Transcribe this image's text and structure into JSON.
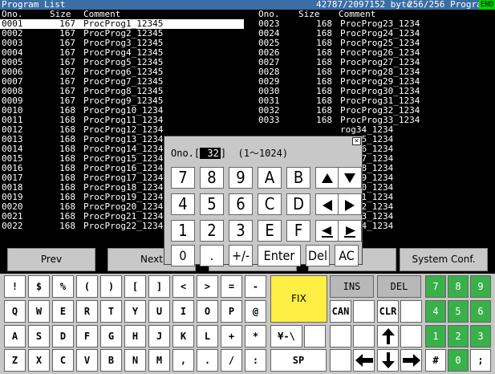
{
  "title": {
    "name": "Program List",
    "memory": "42787/2097152 byte",
    "count": "256/256 Program",
    "end": "END"
  },
  "columns": {
    "no": "Ono.",
    "size": "Size",
    "comment": "Comment"
  },
  "left_rows": [
    [
      "0001",
      "167",
      "ProcProg1_12345"
    ],
    [
      "0002",
      "167",
      "ProcProg2_12345"
    ],
    [
      "0003",
      "167",
      "ProcProg3_12345"
    ],
    [
      "0004",
      "167",
      "ProcProg4_12345"
    ],
    [
      "0005",
      "167",
      "ProcProg5_12345"
    ],
    [
      "0006",
      "167",
      "ProcProg6_12345"
    ],
    [
      "0007",
      "167",
      "ProcProg7_12345"
    ],
    [
      "0008",
      "167",
      "ProcProg8_12345"
    ],
    [
      "0009",
      "167",
      "ProcProg9_12345"
    ],
    [
      "0010",
      "168",
      "ProcProg10_1234"
    ],
    [
      "0011",
      "168",
      "ProcProg11_1234"
    ],
    [
      "0012",
      "168",
      "ProcProg12_1234"
    ],
    [
      "0013",
      "168",
      "ProcProg13_1234"
    ],
    [
      "0014",
      "168",
      "ProcProg14_1234"
    ],
    [
      "0015",
      "168",
      "ProcProg15_1234"
    ],
    [
      "0016",
      "168",
      "ProcProg16_1234"
    ],
    [
      "0017",
      "168",
      "ProcProg17_1234"
    ],
    [
      "0018",
      "168",
      "ProcProg18_1234"
    ],
    [
      "0019",
      "168",
      "ProcProg19_1234"
    ],
    [
      "0020",
      "168",
      "ProcProg20_1234"
    ],
    [
      "0021",
      "168",
      "ProcProg21_1234"
    ],
    [
      "0022",
      "168",
      "ProcProg22_1234"
    ]
  ],
  "right_rows": [
    [
      "0023",
      "168",
      "ProcProg23_1234"
    ],
    [
      "0024",
      "168",
      "ProcProg24_1234"
    ],
    [
      "0025",
      "168",
      "ProcProg25_1234"
    ],
    [
      "0026",
      "168",
      "ProcProg26_1234"
    ],
    [
      "0027",
      "168",
      "ProcProg27_1234"
    ],
    [
      "0028",
      "168",
      "ProcProg28_1234"
    ],
    [
      "0029",
      "168",
      "ProcProg29_1234"
    ],
    [
      "0030",
      "168",
      "ProcProg30_1234"
    ],
    [
      "0031",
      "168",
      "ProcProg31_1234"
    ],
    [
      "0032",
      "168",
      "ProcProg32_1234"
    ],
    [
      "0033",
      "168",
      "ProcProg33_1234"
    ],
    [
      "",
      "",
      "rog34_1234"
    ],
    [
      "",
      "",
      "rog35_1234"
    ],
    [
      "",
      "",
      "rog36_1234"
    ],
    [
      "",
      "",
      "rog37_1234"
    ],
    [
      "",
      "",
      "rog38_1234"
    ],
    [
      "",
      "",
      "rog39_1234"
    ],
    [
      "",
      "",
      "rog40_1234"
    ],
    [
      "",
      "",
      "rog41_1234"
    ],
    [
      "",
      "",
      "rog42_1234"
    ],
    [
      "",
      "",
      "rog43_1234"
    ],
    [
      "",
      "",
      "rog44_1234"
    ]
  ],
  "fkeys": {
    "prev": "Prev",
    "next": "Next",
    "system": "System Conf."
  },
  "dialog": {
    "label": "Ono.[",
    "value": " 32",
    "range": "]  (1～1024)",
    "close": "×",
    "keys": [
      "7",
      "8",
      "9",
      "A",
      "B",
      "up",
      "down",
      "4",
      "5",
      "6",
      "C",
      "D",
      "left",
      "right",
      "1",
      "2",
      "3",
      "E",
      "F",
      "home",
      "end",
      "0",
      ".",
      "+/-",
      "Enter",
      "Del",
      "AC"
    ]
  },
  "keyboard": {
    "row1": [
      "!",
      "$",
      "%",
      "(",
      ")",
      "[",
      "]",
      "<",
      ">",
      "=",
      "-"
    ],
    "row2": [
      "Q",
      "W",
      "E",
      "R",
      "T",
      "Y",
      "U",
      "I",
      "O",
      "P",
      "@"
    ],
    "row3": [
      "A",
      "S",
      "D",
      "F",
      "G",
      "H",
      "J",
      "K",
      "L",
      "+",
      "*"
    ],
    "row4": [
      "Z",
      "X",
      "C",
      "V",
      "B",
      "N",
      "M",
      ",",
      ".",
      "/",
      ":"
    ],
    "fix": "FIX",
    "ins": "INS",
    "del": "DEL",
    "can": "CAN",
    "clr": "CLR",
    "yen": "¥-\\",
    "sp": "SP",
    "num": [
      "7",
      "8",
      "9",
      "4",
      "5",
      "6",
      "1",
      "2",
      "3",
      "#",
      "0",
      ";"
    ]
  },
  "colors": {
    "title_bg": "#3a6ea5",
    "end_badge": "#00d000",
    "fix_key": "#ffee44",
    "num_key": "#39b04a"
  }
}
